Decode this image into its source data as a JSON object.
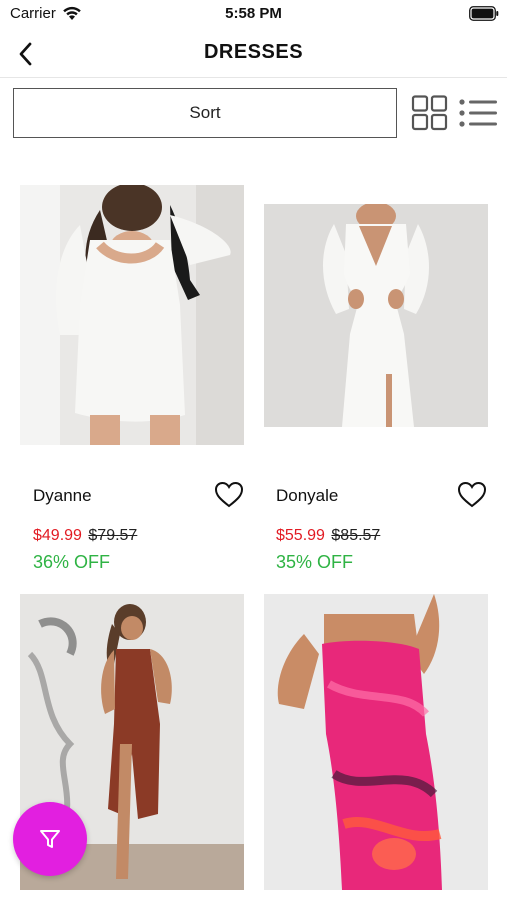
{
  "status_bar": {
    "carrier": "Carrier",
    "time": "5:58 PM",
    "wifi_icon": "wifi-icon",
    "battery_icon": "battery-icon"
  },
  "nav": {
    "title": "DRESSES",
    "back_icon": "chevron-left-icon"
  },
  "toolbar": {
    "sort_label": "Sort",
    "grid_icon": "grid-view-icon",
    "list_icon": "list-view-icon"
  },
  "products": [
    {
      "name": "Dyanne",
      "price": "$49.99",
      "original_price": "$79.57",
      "discount": "36% OFF",
      "favorite_icon": "heart-outline-icon"
    },
    {
      "name": "Donyale",
      "price": "$55.99",
      "original_price": "$85.57",
      "discount": "35% OFF",
      "favorite_icon": "heart-outline-icon"
    },
    {
      "name": "",
      "price": "",
      "original_price": "",
      "discount": ""
    },
    {
      "name": "",
      "price": "",
      "original_price": "",
      "discount": ""
    }
  ],
  "filter_button": {
    "icon": "filter-funnel-icon"
  },
  "colors": {
    "sale_price": "#e21b23",
    "discount": "#2fb344",
    "filter_fab": "#e21fe0",
    "product_4_dress": "#e8287a",
    "product_3_dress": "#8b3a26"
  }
}
